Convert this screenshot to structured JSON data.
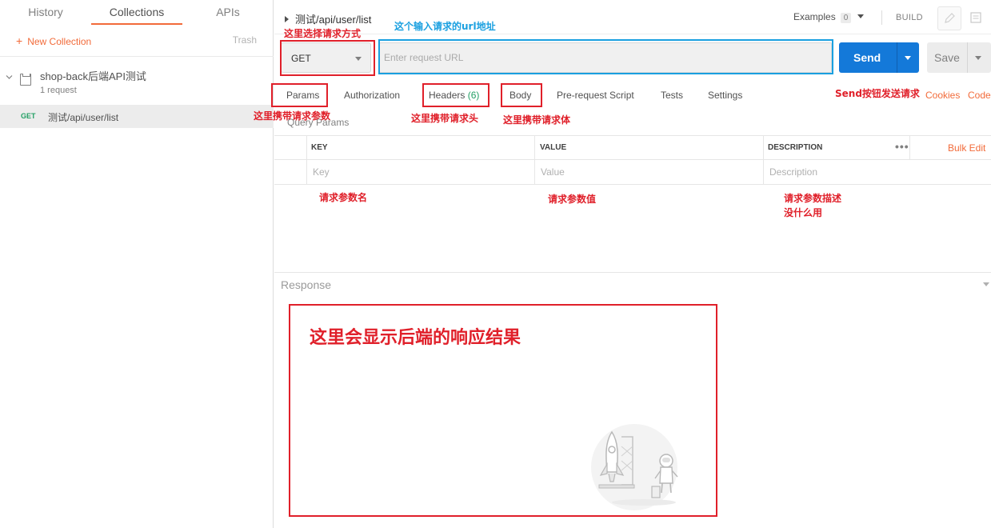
{
  "sidebar": {
    "tabs": [
      "History",
      "Collections",
      "APIs"
    ],
    "new_collection": "New Collection",
    "trash": "Trash",
    "collection": {
      "name": "shop-back后端API测试",
      "count": "1 request"
    },
    "request": {
      "method": "GET",
      "name": "测试/api/user/list"
    }
  },
  "header": {
    "title": "测试/api/user/list",
    "examples_label": "Examples",
    "examples_count": "0",
    "build": "BUILD"
  },
  "request_bar": {
    "method": "GET",
    "url_placeholder": "Enter request URL",
    "send": "Send",
    "save": "Save"
  },
  "request_tabs": {
    "params": "Params",
    "authorization": "Authorization",
    "headers": "Headers",
    "headers_count": "(6)",
    "body": "Body",
    "prerequest": "Pre-request Script",
    "tests": "Tests",
    "settings": "Settings",
    "cookies": "Cookies",
    "code": "Code"
  },
  "params": {
    "section": "Query Params",
    "headers": {
      "key": "KEY",
      "value": "VALUE",
      "description": "DESCRIPTION",
      "bulk_edit": "Bulk Edit"
    },
    "placeholders": {
      "key": "Key",
      "value": "Value",
      "description": "Description"
    }
  },
  "response": {
    "label": "Response"
  },
  "annotations": {
    "method": "这里选择请求方式",
    "url": "这个输入请求的url地址",
    "send": "Send按钮发送请求",
    "params": "这里携带请求参数",
    "headers": "这里携带请求头",
    "body": "这里携带请求体",
    "key": "请求参数名",
    "value": "请求参数值",
    "desc_line1": "请求参数描述",
    "desc_line2": "没什么用",
    "response": "这里会显示后端的响应结果"
  },
  "colors": {
    "accent": "#f26b3a",
    "send": "#1479d9",
    "annotation_red": "#e0202a",
    "annotation_blue": "#1aa0e0",
    "get_method": "#23a065"
  }
}
